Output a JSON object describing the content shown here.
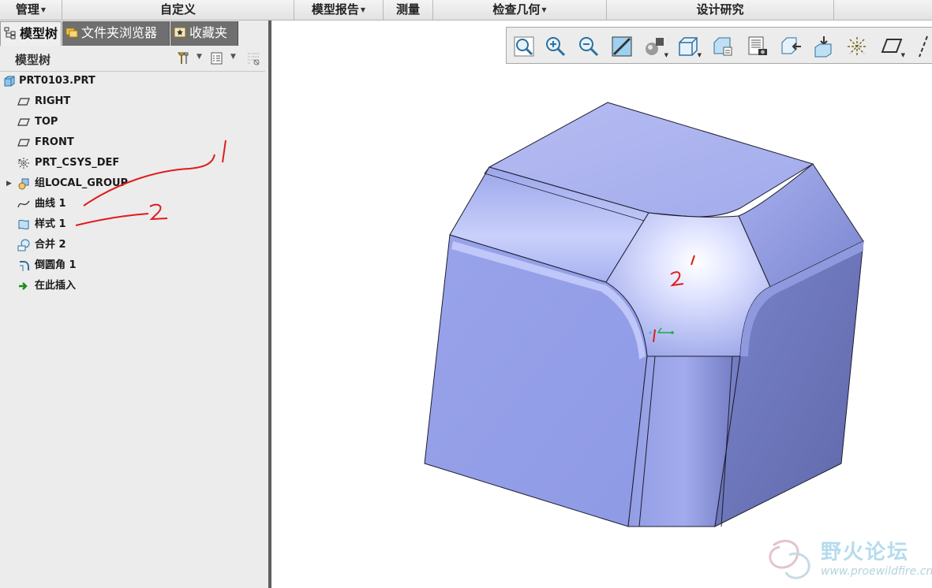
{
  "ribbon_groups": [
    {
      "label": "管理",
      "dropdown": true
    },
    {
      "label": "自定义",
      "dropdown": false
    },
    {
      "label": "模型报告",
      "dropdown": true
    },
    {
      "label": "测量",
      "dropdown": false
    },
    {
      "label": "检查几何",
      "dropdown": true
    },
    {
      "label": "设计研究",
      "dropdown": false
    }
  ],
  "navigator_tabs": [
    {
      "label": "模型树",
      "icon": "model-tree-icon",
      "active": true
    },
    {
      "label": "文件夹浏览器",
      "icon": "folder-browser-icon",
      "active": false
    },
    {
      "label": "收藏夹",
      "icon": "favorites-icon",
      "active": false
    }
  ],
  "tree_header": {
    "title": "模型树",
    "settings_icon": "tree-settings-icon",
    "columns_icon": "tree-columns-icon",
    "filter_icon": "tree-filter-icon"
  },
  "tree_items": [
    {
      "label": "PRT0103.PRT",
      "icon": "part-icon",
      "level": 0
    },
    {
      "label": "RIGHT",
      "icon": "datum-plane-icon",
      "level": 1
    },
    {
      "label": "TOP",
      "icon": "datum-plane-icon",
      "level": 1
    },
    {
      "label": "FRONT",
      "icon": "datum-plane-icon",
      "level": 1
    },
    {
      "label": "PRT_CSYS_DEF",
      "icon": "coordinate-system-icon",
      "level": 1
    },
    {
      "label": "组LOCAL_GROUP",
      "icon": "group-icon",
      "level": 1,
      "expandable": true
    },
    {
      "label": "曲线 1",
      "icon": "curve-icon",
      "level": 1
    },
    {
      "label": "样式 1",
      "icon": "style-icon",
      "level": 1
    },
    {
      "label": "合并 2",
      "icon": "merge-icon",
      "level": 1
    },
    {
      "label": "倒圆角 1",
      "icon": "round-icon",
      "level": 1
    },
    {
      "label": "在此插入",
      "icon": "insert-here-arrow-icon",
      "level": 1
    }
  ],
  "graphics_toolbar": [
    {
      "name": "refit-icon",
      "dropdown": false
    },
    {
      "name": "zoom-in-icon",
      "dropdown": false
    },
    {
      "name": "zoom-out-icon",
      "dropdown": false
    },
    {
      "name": "repaint-icon",
      "dropdown": false
    },
    {
      "name": "display-style-icon",
      "dropdown": true
    },
    {
      "name": "saved-orientations-icon",
      "dropdown": true
    },
    {
      "name": "view-manager-icon",
      "dropdown": false
    },
    {
      "name": "perspective-view-icon",
      "dropdown": false
    },
    {
      "name": "annotation-display-icon",
      "dropdown": false
    },
    {
      "name": "section-icon",
      "dropdown": false
    },
    {
      "name": "spin-center-icon",
      "dropdown": false
    },
    {
      "name": "datum-display-icon",
      "dropdown": false
    },
    {
      "name": "plane-display-icon",
      "dropdown": false
    },
    {
      "name": "axis-display-icon",
      "dropdown": false
    }
  ],
  "handwritten_annotations": [
    "1",
    "2"
  ],
  "model_annotations": [
    "1",
    "2"
  ],
  "watermark": {
    "title": "野火论坛",
    "url": "www.proewildfire.cn"
  },
  "colors": {
    "model_face": "#9aa4e6",
    "accent_red": "#e01b1b",
    "splitter": "#5e5e5e"
  }
}
